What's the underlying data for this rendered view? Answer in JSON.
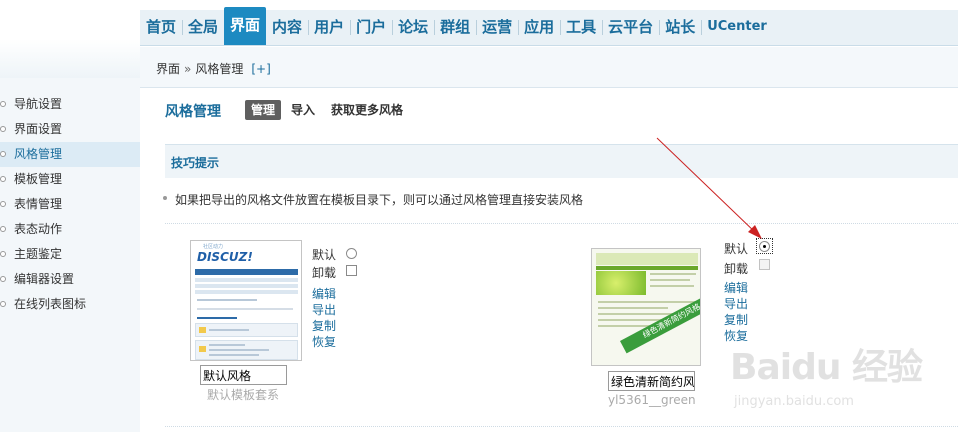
{
  "nav": {
    "items": [
      "首页",
      "全局",
      "界面",
      "内容",
      "用户",
      "门户",
      "论坛",
      "群组",
      "运营",
      "应用",
      "工具",
      "云平台",
      "站长",
      "UCenter"
    ],
    "active_index": 2
  },
  "breadcrumb": {
    "parent": "界面",
    "separator": "»",
    "current": "风格管理",
    "add_label": "[+]"
  },
  "sidebar": {
    "items": [
      "导航设置",
      "界面设置",
      "风格管理",
      "模板管理",
      "表情管理",
      "表态动作",
      "主题鉴定",
      "编辑器设置",
      "在线列表图标"
    ],
    "active_index": 2
  },
  "main": {
    "title": "风格管理",
    "tabs": [
      "管理",
      "导入",
      "获取更多风格"
    ],
    "active_tab": 0,
    "tips_title": "技巧提示",
    "tip": "如果把导出的风格文件放置在模板目录下，则可以通过风格管理直接安装风格"
  },
  "styles": [
    {
      "thumb_logo": "DISCUZ!",
      "thumb_logo_sub": "社区动力",
      "name": "默认风格",
      "directory": "默认模板套系",
      "default_label": "默认",
      "default_checked": false,
      "uninstall_label": "卸载",
      "uninstall_disabled": false,
      "actions": [
        "编辑",
        "导出",
        "复制",
        "恢复"
      ]
    },
    {
      "thumb_ribbon": "绿色清新简约风格",
      "name": "绿色清新简约风",
      "directory": "yl5361__green",
      "default_label": "默认",
      "default_checked": true,
      "uninstall_label": "卸载",
      "uninstall_disabled": true,
      "actions": [
        "编辑",
        "导出",
        "复制",
        "恢复"
      ]
    }
  ],
  "colors": {
    "accent": "#1b6d9c",
    "nav_active": "#1d8ac1",
    "annotation_arrow": "#cc2222"
  },
  "watermark": {
    "brand": "Baidu 经验",
    "url": "jingyan.baidu.com"
  }
}
